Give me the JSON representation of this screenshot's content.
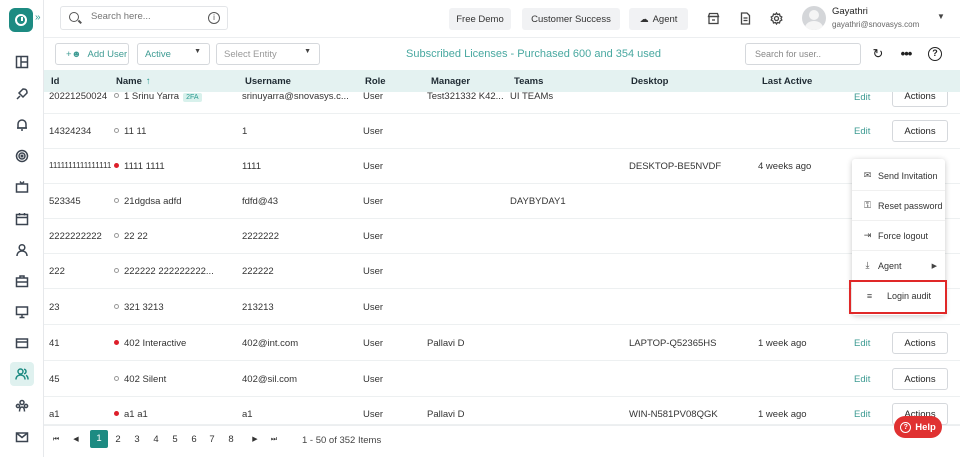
{
  "topbar": {
    "search_placeholder": "Search here...",
    "free_demo": "Free Demo",
    "customer_success": "Customer Success",
    "agent": "Agent",
    "user_name": "Gayathri",
    "user_email": "gayathri@snovasys.com"
  },
  "toolbar": {
    "add_user": "Add User",
    "status_filter": "Active",
    "entity_placeholder": "Select Entity",
    "subscription": "Subscribed Licenses - Purchased 600 and 354 used",
    "user_search_placeholder": "Search for user.."
  },
  "table": {
    "columns": {
      "id": "Id",
      "name": "Name",
      "username": "Username",
      "role": "Role",
      "manager": "Manager",
      "teams": "Teams",
      "desktop": "Desktop",
      "last_active": "Last Active"
    },
    "rows": [
      {
        "id": "20221250024",
        "name": "1 Srinu Yarra",
        "online": false,
        "twofa": "2FA",
        "username": "srinuyarra@snovasys.c...",
        "role": "User",
        "manager": "Test321332 K42...",
        "teams": "UI TEAMs",
        "desktop": "",
        "last_active": "",
        "edit": "Edit",
        "actions": "Actions"
      },
      {
        "id": "14324234",
        "name": "11 11",
        "online": false,
        "username": "1",
        "role": "User",
        "manager": "",
        "teams": "",
        "desktop": "",
        "last_active": "",
        "edit": "Edit",
        "actions": "Actions"
      },
      {
        "id": "1111111111111111",
        "name": "1111 1111",
        "online": true,
        "username": "1111",
        "role": "User",
        "manager": "",
        "teams": "",
        "desktop": "DESKTOP-BE5NVDF",
        "last_active": "4 weeks ago",
        "edit": "",
        "actions": ""
      },
      {
        "id": "523345",
        "name": "21dgdsa adfd",
        "online": false,
        "username": "fdfd@43",
        "role": "User",
        "manager": "",
        "teams": "DAYBYDAY1",
        "desktop": "",
        "last_active": "",
        "edit": "",
        "actions": ""
      },
      {
        "id": "2222222222",
        "name": "22 22",
        "online": false,
        "username": "2222222",
        "role": "User",
        "manager": "",
        "teams": "",
        "desktop": "",
        "last_active": "",
        "edit": "",
        "actions": ""
      },
      {
        "id": "222",
        "name": "222222 222222222...",
        "online": false,
        "username": "222222",
        "role": "User",
        "manager": "",
        "teams": "",
        "desktop": "",
        "last_active": "",
        "edit": "",
        "actions": ""
      },
      {
        "id": "23",
        "name": "321 3213",
        "online": false,
        "username": "213213",
        "role": "User",
        "manager": "",
        "teams": "",
        "desktop": "",
        "last_active": "",
        "edit": "",
        "actions": ""
      },
      {
        "id": "41",
        "name": "402 Interactive",
        "online": true,
        "username": "402@int.com",
        "role": "User",
        "manager": "Pallavi D",
        "teams": "",
        "desktop": "LAPTOP-Q52365HS",
        "last_active": "1 week ago",
        "edit": "Edit",
        "actions": "Actions"
      },
      {
        "id": "45",
        "name": "402 Silent",
        "online": false,
        "username": "402@sil.com",
        "role": "User",
        "manager": "",
        "teams": "",
        "desktop": "",
        "last_active": "",
        "edit": "Edit",
        "actions": "Actions"
      },
      {
        "id": "a1",
        "name": "a1 a1",
        "online": true,
        "username": "a1",
        "role": "User",
        "manager": "Pallavi D",
        "teams": "",
        "desktop": "WIN-N581PV08QGK",
        "last_active": "1 week ago",
        "edit": "Edit",
        "actions": "Actions"
      }
    ]
  },
  "menu": {
    "send_invitation": "Send Invitation",
    "reset_password": "Reset password",
    "force_logout": "Force logout",
    "agent": "Agent",
    "login_audit": "Login audit"
  },
  "pagination": {
    "pages": [
      "1",
      "2",
      "3",
      "4",
      "5",
      "6",
      "7",
      "8"
    ],
    "current": "1",
    "info": "1 - 50 of 352 Items"
  },
  "help": "Help"
}
